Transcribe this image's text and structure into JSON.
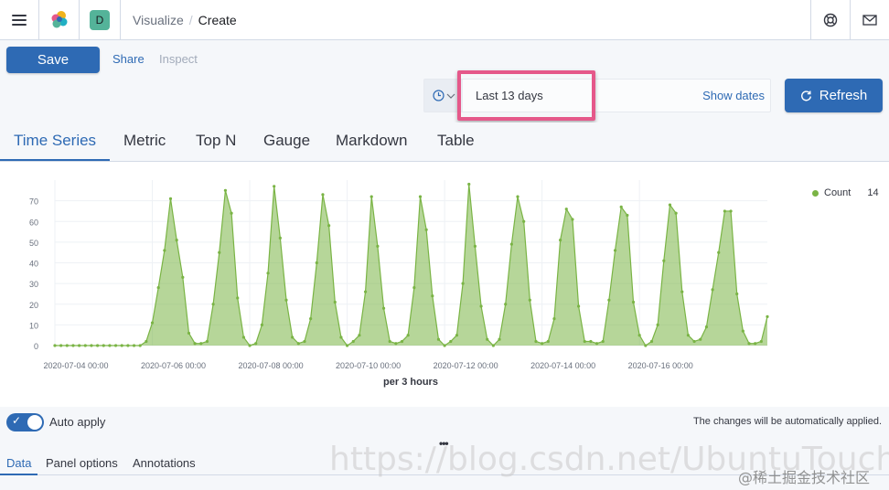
{
  "header": {
    "space_initial": "D",
    "breadcrumb_parent": "Visualize",
    "breadcrumb_separator": "/",
    "breadcrumb_current": "Create"
  },
  "toolbar": {
    "save_label": "Save",
    "share_label": "Share",
    "inspect_label": "Inspect"
  },
  "datepicker": {
    "range_label": "Last 13 days",
    "show_dates_label": "Show dates",
    "refresh_label": "Refresh"
  },
  "tabs": [
    {
      "label": "Time Series",
      "active": true
    },
    {
      "label": "Metric",
      "active": false
    },
    {
      "label": "Top N",
      "active": false
    },
    {
      "label": "Gauge",
      "active": false
    },
    {
      "label": "Markdown",
      "active": false
    },
    {
      "label": "Table",
      "active": false
    }
  ],
  "legend": {
    "series_name": "Count",
    "series_value": "14",
    "color": "#7ab445"
  },
  "chart_data": {
    "type": "area",
    "xlabel": "per 3 hours",
    "ylim": [
      0,
      80
    ],
    "y_ticks": [
      "0",
      "10",
      "20",
      "30",
      "40",
      "50",
      "60",
      "70"
    ],
    "x_ticks": [
      "2020-07-04 00:00",
      "2020-07-06 00:00",
      "2020-07-08 00:00",
      "2020-07-10 00:00",
      "2020-07-12 00:00",
      "2020-07-14 00:00",
      "2020-07-16 00:00"
    ],
    "series": [
      {
        "name": "Count",
        "color": "#7ab445",
        "values": [
          0,
          0,
          0,
          0,
          0,
          0,
          0,
          0,
          0,
          0,
          0,
          0,
          0,
          0,
          0,
          2,
          11,
          28,
          46,
          71,
          51,
          33,
          6,
          1,
          1,
          2,
          20,
          45,
          75,
          64,
          23,
          4,
          0,
          1,
          10,
          35,
          77,
          52,
          22,
          4,
          1,
          2,
          13,
          40,
          73,
          58,
          21,
          4,
          0,
          2,
          5,
          26,
          72,
          48,
          18,
          2,
          1,
          2,
          5,
          28,
          72,
          56,
          24,
          3,
          0,
          2,
          5,
          30,
          78,
          48,
          19,
          3,
          0,
          3,
          20,
          49,
          72,
          60,
          22,
          2,
          1,
          2,
          13,
          51,
          66,
          61,
          19,
          2,
          2,
          1,
          2,
          22,
          46,
          67,
          63,
          21,
          5,
          0,
          2,
          10,
          41,
          68,
          64,
          26,
          5,
          2,
          3,
          9,
          27,
          45,
          65,
          65,
          25,
          7,
          1,
          1,
          2,
          14
        ]
      }
    ]
  },
  "bottom": {
    "auto_apply_label": "Auto apply",
    "auto_apply_message": "The changes will be automatically applied.",
    "resize_handle": "•••",
    "tabs": [
      {
        "label": "Data",
        "active": true
      },
      {
        "label": "Panel options",
        "active": false
      },
      {
        "label": "Annotations",
        "active": false
      }
    ]
  },
  "watermark": {
    "url_text": "https://blog.csdn.net/UbuntuTouch",
    "credit_text": "@稀土掘金技术社区"
  }
}
